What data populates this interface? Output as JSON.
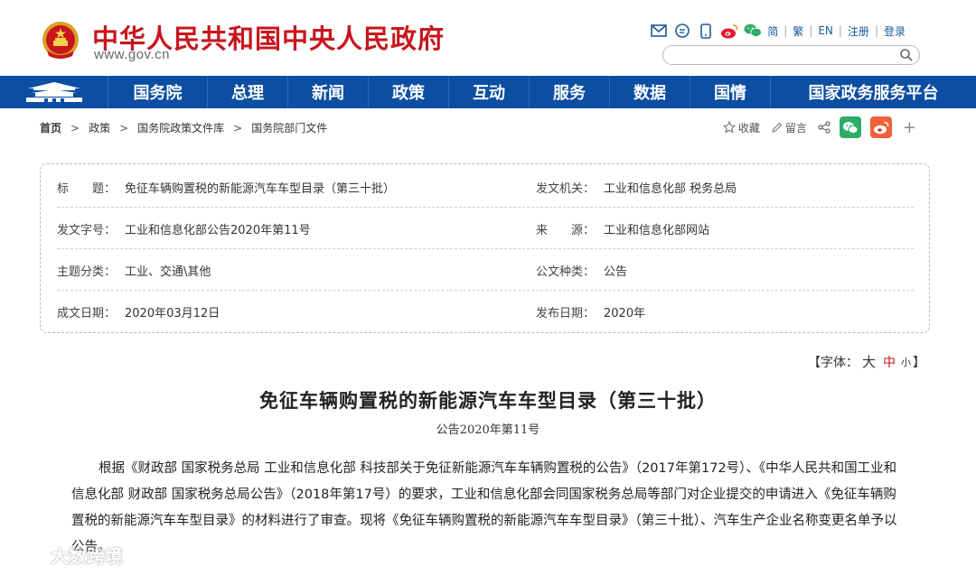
{
  "header": {
    "site_title": "中华人民共和国中央人民政府",
    "site_url": "www.gov.cn",
    "links": [
      "简",
      "繁",
      "EN",
      "注册",
      "登录"
    ],
    "search_placeholder": ""
  },
  "nav": {
    "items": [
      "国务院",
      "总理",
      "新闻",
      "政策",
      "互动",
      "服务",
      "数据",
      "国情",
      "国家政务服务平台"
    ]
  },
  "breadcrumb": {
    "items": [
      "首页",
      "政策",
      "国务院政策文件库",
      "国务院部门文件"
    ],
    "separator": ">"
  },
  "tools": {
    "favorite": "收藏",
    "comment": "留言",
    "plus": "+"
  },
  "info": {
    "title_label": "标　　题：",
    "title_value": "免征车辆购置税的新能源汽车车型目录（第三十批）",
    "issuer_label": "发文机关：",
    "issuer_value": "工业和信息化部 税务总局",
    "docno_label": "发文字号：",
    "docno_value": "工业和信息化部公告2020年第11号",
    "source_label": "来　　源：",
    "source_value": "工业和信息化部网站",
    "topic_label": "主题分类：",
    "topic_value": "工业、交通\\其他",
    "type_label": "公文种类：",
    "type_value": "公告",
    "date_label": "成文日期：",
    "date_value": "2020年03月12日",
    "pub_label": "发布日期：",
    "pub_value": "2020年"
  },
  "fontsize": {
    "open": "【",
    "label": "字体：",
    "large": "大",
    "medium": "中",
    "small": "小",
    "close": "】"
  },
  "article": {
    "title": "免征车辆购置税的新能源汽车车型目录（第三十批）",
    "subtitle": "公告2020年第11号",
    "paragraph": "根据《财政部 国家税务总局 工业和信息化部 科技部关于免征新能源汽车车辆购置税的公告》（2017年第172号）、《中华人民共和国工业和信息化部 财政部 国家税务总局公告》（2018年第17号）的要求，工业和信息化部会同国家税务总局等部门对企业提交的申请进入《免征车辆购置税的新能源汽车车型目录》的材料进行了审查。现将《免征车辆购置税的新能源汽车车型目录》（第三十批）、汽车生产企业名称变更名单予以公告。"
  },
  "watermark": {
    "text": "大数跨境"
  },
  "colors": {
    "brand_red": "#c8161d",
    "nav_blue": "#0b4ea2",
    "wechat_green": "#2aae67",
    "weibo_orange": "#f0603a"
  }
}
